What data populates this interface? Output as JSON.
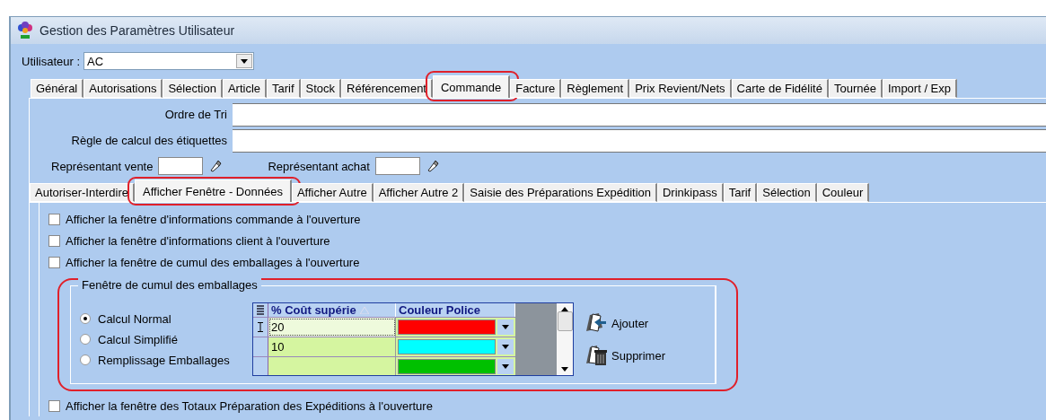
{
  "window": {
    "title": "Gestion des Paramètres Utilisateur"
  },
  "user": {
    "label": "Utilisateur :",
    "value": "AC"
  },
  "tabs": [
    {
      "label": "Général",
      "selected": false
    },
    {
      "label": "Autorisations",
      "selected": false
    },
    {
      "label": "Sélection",
      "selected": false
    },
    {
      "label": "Article",
      "selected": false
    },
    {
      "label": "Tarif",
      "selected": false
    },
    {
      "label": "Stock",
      "selected": false
    },
    {
      "label": "Référencement",
      "selected": false
    },
    {
      "label": "Commande",
      "selected": true,
      "highlighted": true
    },
    {
      "label": "Facture",
      "selected": false
    },
    {
      "label": "Règlement",
      "selected": false
    },
    {
      "label": "Prix Revient/Nets",
      "selected": false
    },
    {
      "label": "Carte de Fidélité",
      "selected": false
    },
    {
      "label": "Tournée",
      "selected": false
    },
    {
      "label": "Import / Exp",
      "selected": false
    }
  ],
  "fields": [
    {
      "label": "Ordre de Tri"
    },
    {
      "label": "Règle de calcul des étiquettes"
    }
  ],
  "representants": [
    {
      "label": "Représentant vente"
    },
    {
      "label": "Représentant achat"
    }
  ],
  "subtabs": [
    {
      "label": "Autoriser-Interdire",
      "selected": false
    },
    {
      "label": "Afficher Fenêtre - Données",
      "selected": true,
      "highlighted": true
    },
    {
      "label": "Afficher Autre",
      "selected": false
    },
    {
      "label": "Afficher Autre 2",
      "selected": false
    },
    {
      "label": "Saisie des Préparations Expédition",
      "selected": false
    },
    {
      "label": "Drinkipass",
      "selected": false
    },
    {
      "label": "Tarif",
      "selected": false
    },
    {
      "label": "Sélection",
      "selected": false
    },
    {
      "label": "Couleur",
      "selected": false
    }
  ],
  "checkboxes": [
    {
      "label": "Afficher la fenêtre d'informations commande à l'ouverture",
      "checked": false
    },
    {
      "label": "Afficher la fenêtre d'informations client à l'ouverture",
      "checked": false
    },
    {
      "label": "Afficher la fenêtre de cumul des emballages à l'ouverture",
      "checked": false
    }
  ],
  "group": {
    "title": "Fenêtre de cumul des emballages",
    "highlighted": true,
    "radios": [
      {
        "label": "Calcul Normal",
        "selected": true
      },
      {
        "label": "Calcul Simplifié",
        "selected": false
      },
      {
        "label": "Remplissage Emballages",
        "selected": false
      }
    ],
    "table": {
      "columns": [
        "% Coût supérie",
        "Couleur Police"
      ],
      "rows": [
        {
          "value": "20",
          "color": "#ff0000",
          "selected": true
        },
        {
          "value": "10",
          "color": "#00ffff",
          "selected": false
        },
        {
          "color": "#00c000",
          "selected": false
        }
      ]
    },
    "buttons": [
      {
        "label": "Ajouter",
        "kind": "add"
      },
      {
        "label": "Supprimer",
        "kind": "delete"
      }
    ]
  },
  "last_checkbox": {
    "label": "Afficher la fenêtre des Totaux Préparation des Expéditions à l'ouverture",
    "checked": false
  }
}
